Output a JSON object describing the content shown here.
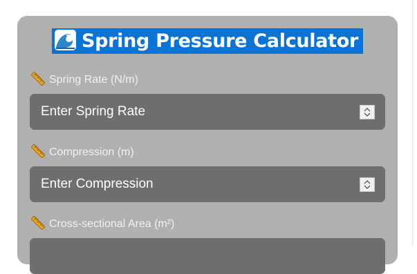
{
  "app": {
    "title": "Spring Pressure Calculator",
    "title_icon": "water-wave-icon"
  },
  "fields": [
    {
      "label": "Spring Rate (N/m)",
      "placeholder": "Enter Spring Rate",
      "value": "",
      "icon": "ruler-icon"
    },
    {
      "label": "Compression (m)",
      "placeholder": "Enter Compression",
      "value": "",
      "icon": "ruler-icon"
    },
    {
      "label": "Cross-sectional Area (m²)",
      "placeholder": "",
      "value": "",
      "icon": "ruler-icon"
    }
  ],
  "colors": {
    "card_background": "#b0b0b0",
    "input_background": "#6e6e6e",
    "title_highlight": "#0a74d6",
    "label_text": "#f2f2f2"
  }
}
